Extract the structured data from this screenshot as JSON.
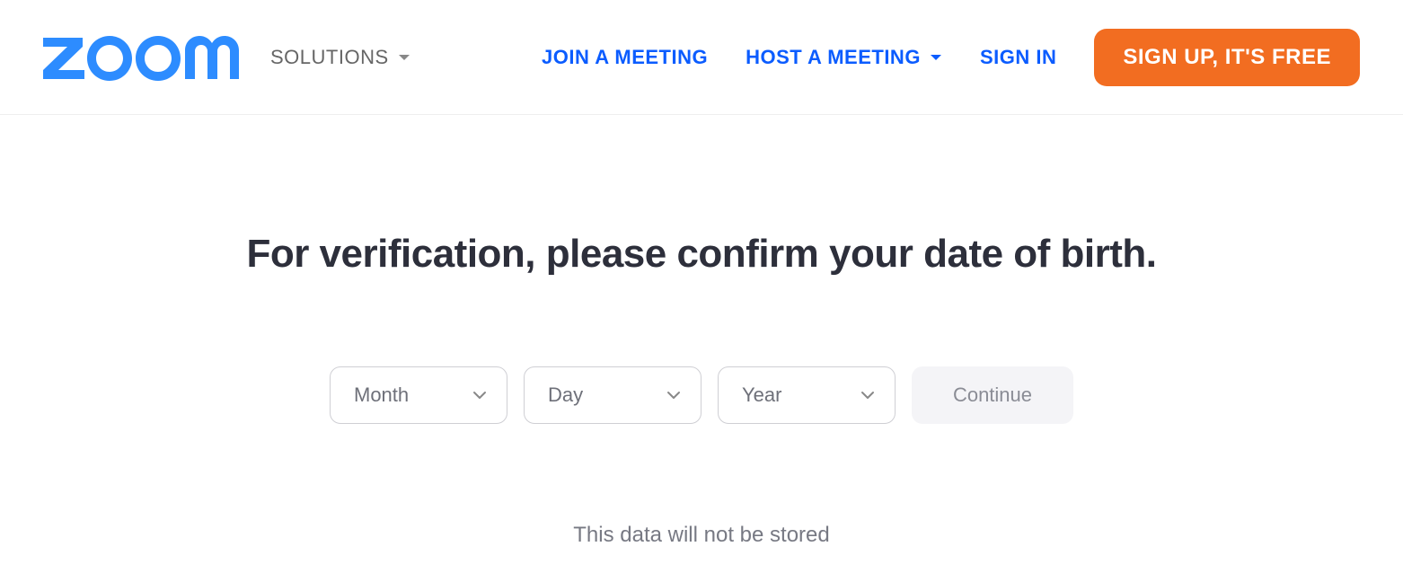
{
  "header": {
    "solutions_label": "SOLUTIONS",
    "join_label": "JOIN A MEETING",
    "host_label": "HOST A MEETING",
    "signin_label": "SIGN IN",
    "signup_label": "SIGN UP, IT'S FREE"
  },
  "main": {
    "heading": "For verification, please confirm your date of birth.",
    "month_placeholder": "Month",
    "day_placeholder": "Day",
    "year_placeholder": "Year",
    "continue_label": "Continue",
    "note": "This data will not be stored"
  }
}
